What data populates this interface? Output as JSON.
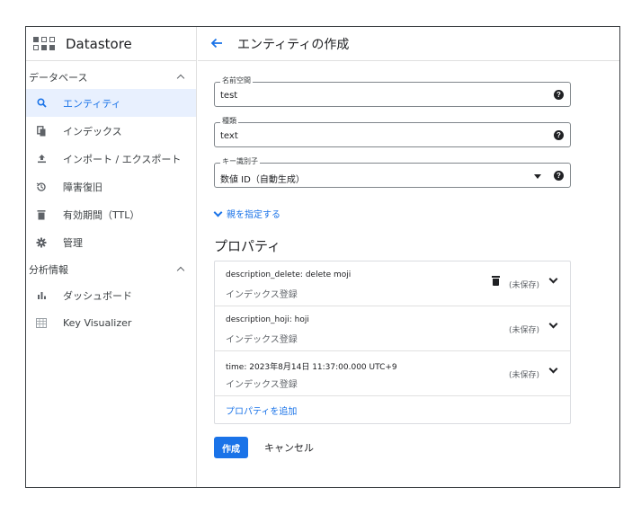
{
  "sidebar": {
    "app_title": "Datastore",
    "section_db": "データベース",
    "items": [
      {
        "label": "エンティティ",
        "icon": "search-icon"
      },
      {
        "label": "インデックス",
        "icon": "index-icon"
      },
      {
        "label": "インポート / エクスポート",
        "icon": "upload-icon"
      },
      {
        "label": "障害復旧",
        "icon": "history-icon"
      },
      {
        "label": "有効期間（TTL）",
        "icon": "trash-icon"
      },
      {
        "label": "管理",
        "icon": "gear-icon"
      }
    ],
    "section_analytics": "分析情報",
    "analytics_items": [
      {
        "label": "ダッシュボード",
        "icon": "bar-chart-icon"
      },
      {
        "label": "Key Visualizer",
        "icon": "heatmap-icon"
      }
    ]
  },
  "header": {
    "title": "エンティティの作成"
  },
  "form": {
    "namespace": {
      "label": "名前空間",
      "value": "test"
    },
    "kind": {
      "label": "種類",
      "value": "text"
    },
    "key": {
      "label": "キー識別子",
      "value": "数値 ID（自動生成）"
    },
    "parent_link": "親を指定する",
    "properties_title": "プロパティ",
    "properties": [
      {
        "name": "description_delete:",
        "value": "delete moji",
        "sub": "インデックス登録",
        "status": "(未保存)"
      },
      {
        "name": "description_hoji:",
        "value": "hoji",
        "sub": "インデックス登録",
        "status": "(未保存)"
      },
      {
        "name": "time:",
        "value": "2023年8月14日 11:37:00.000 UTC+9",
        "sub": "インデックス登録",
        "status": "(未保存)"
      }
    ],
    "add_property": "プロパティを追加",
    "create_label": "作成",
    "cancel_label": "キャンセル"
  },
  "colors": {
    "accent": "#1a73e8",
    "active_bg": "#e8f0fe"
  }
}
